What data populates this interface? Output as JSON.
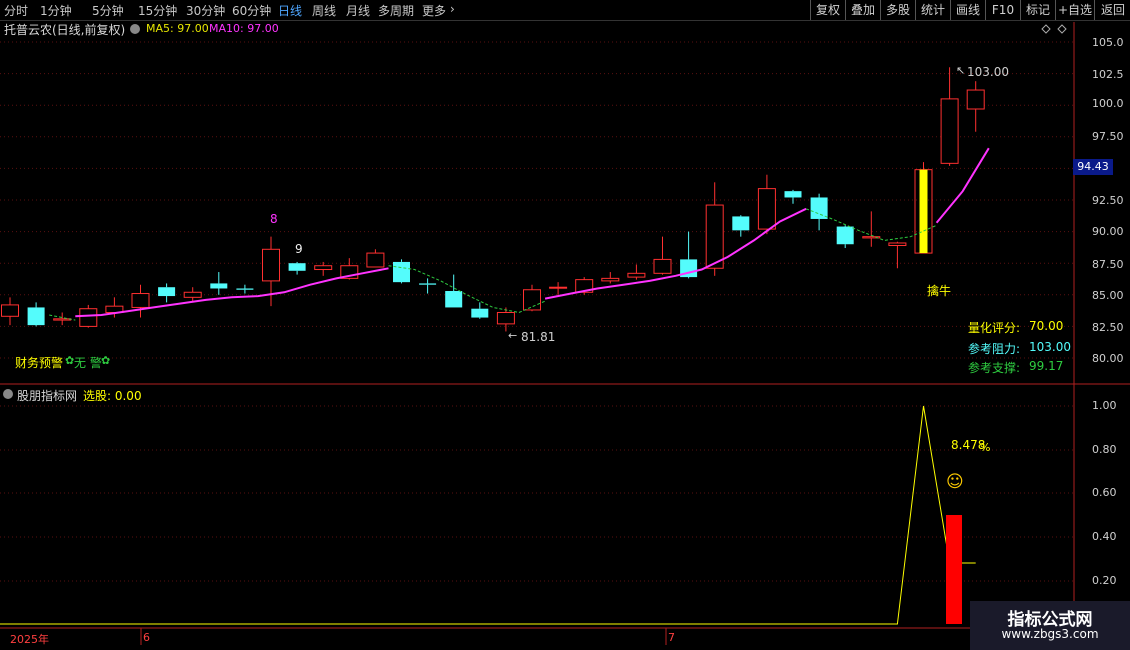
{
  "toolbar": {
    "periods": [
      "分时",
      "1分钟",
      "5分钟",
      "15分钟",
      "30分钟",
      "60分钟",
      "日线",
      "周线",
      "月线",
      "多周期",
      "更多"
    ],
    "active_period": "日线",
    "more_arrow": "›",
    "right_buttons": [
      "复权",
      "叠加",
      "多股",
      "统计",
      "画线",
      "F10",
      "标记",
      "+自选",
      "返回"
    ]
  },
  "main_chart": {
    "title": "托普云农(日线,前复权)",
    "ma5": "MA5: 97.00",
    "ma10": "MA10: 97.00",
    "y_ticks": [
      "105.0",
      "102.5",
      "100.0",
      "97.50",
      "95.00",
      "92.50",
      "90.00",
      "87.50",
      "85.00",
      "82.50",
      "80.00"
    ],
    "current_price": "94.43",
    "high_label": "103.00",
    "low_label": "81.81",
    "count_8": "8",
    "count_9": "9",
    "signal_label": "擒牛",
    "finance_warning": "财务预警",
    "finance_status": "无 警",
    "score_label": "量化评分:",
    "score_value": "70.00",
    "resist_label": "参考阻力:",
    "resist_value": "103.00",
    "support_label": "参考支撑:",
    "support_value": "99.17",
    "colors": {
      "up": "#ff3030",
      "down": "#54fcfc",
      "ma10": "#ff33ff",
      "ma5": "#e6e600",
      "signal": "#ffff00"
    }
  },
  "sub_chart": {
    "title": "股朋指标网",
    "select_label": "选股: 0.00",
    "y_ticks": [
      "1.00",
      "0.80",
      "0.60",
      "0.40",
      "0.20"
    ],
    "percent_label": "8.478",
    "percent_sign": "%",
    "smiley": "☺"
  },
  "date_axis": [
    "2025年",
    "6",
    "7"
  ],
  "watermark": {
    "title": "指标公式网",
    "url": "www.zbgs3.com"
  },
  "chart_data": {
    "type": "candlestick",
    "title": "托普云农(日线,前复权)",
    "ylim": [
      78.5,
      106
    ],
    "candles": [
      {
        "o": 83.3,
        "c": 84.2,
        "h": 84.8,
        "l": 82.6
      },
      {
        "o": 84.0,
        "c": 82.6,
        "h": 84.4,
        "l": 82.5
      },
      {
        "o": 83.0,
        "c": 83.1,
        "h": 83.6,
        "l": 82.6
      },
      {
        "o": 82.5,
        "c": 83.9,
        "h": 84.2,
        "l": 82.4
      },
      {
        "o": 83.6,
        "c": 84.1,
        "h": 84.8,
        "l": 83.2
      },
      {
        "o": 84.0,
        "c": 85.1,
        "h": 85.8,
        "l": 83.2
      },
      {
        "o": 85.6,
        "c": 84.9,
        "h": 85.9,
        "l": 84.4
      },
      {
        "o": 84.8,
        "c": 85.2,
        "h": 85.6,
        "l": 84.4
      },
      {
        "o": 85.9,
        "c": 85.5,
        "h": 86.8,
        "l": 85.0
      },
      {
        "o": 85.5,
        "c": 85.4,
        "h": 85.8,
        "l": 85.1
      },
      {
        "o": 86.1,
        "c": 88.6,
        "h": 89.6,
        "l": 84.1
      },
      {
        "o": 87.5,
        "c": 86.9,
        "h": 87.6,
        "l": 86.6
      },
      {
        "o": 87.0,
        "c": 87.3,
        "h": 87.6,
        "l": 86.5
      },
      {
        "o": 86.3,
        "c": 87.3,
        "h": 87.9,
        "l": 86.2
      },
      {
        "o": 87.2,
        "c": 88.3,
        "h": 88.6,
        "l": 87.2
      },
      {
        "o": 87.6,
        "c": 86.0,
        "h": 87.8,
        "l": 85.9
      },
      {
        "o": 85.9,
        "c": 85.8,
        "h": 86.3,
        "l": 85.1
      },
      {
        "o": 85.3,
        "c": 84.0,
        "h": 86.6,
        "l": 84.0
      },
      {
        "o": 83.9,
        "c": 83.2,
        "h": 84.4,
        "l": 83.1
      },
      {
        "o": 82.7,
        "c": 83.6,
        "h": 84.0,
        "l": 82.1
      },
      {
        "o": 83.8,
        "c": 85.4,
        "h": 85.8,
        "l": 83.7
      },
      {
        "o": 85.6,
        "c": 85.6,
        "h": 86.0,
        "l": 85.0
      },
      {
        "o": 85.2,
        "c": 86.2,
        "h": 86.4,
        "l": 85.0
      },
      {
        "o": 86.1,
        "c": 86.3,
        "h": 86.8,
        "l": 85.9
      },
      {
        "o": 86.4,
        "c": 86.7,
        "h": 87.4,
        "l": 86.2
      },
      {
        "o": 86.7,
        "c": 87.8,
        "h": 89.6,
        "l": 86.6
      },
      {
        "o": 87.8,
        "c": 86.4,
        "h": 90.0,
        "l": 86.3
      },
      {
        "o": 87.1,
        "c": 92.1,
        "h": 93.9,
        "l": 86.5
      },
      {
        "o": 91.2,
        "c": 90.1,
        "h": 91.3,
        "l": 89.6
      },
      {
        "o": 90.2,
        "c": 93.4,
        "h": 94.5,
        "l": 89.8
      },
      {
        "o": 93.2,
        "c": 92.7,
        "h": 93.3,
        "l": 92.2
      },
      {
        "o": 92.7,
        "c": 91.0,
        "h": 93.0,
        "l": 90.1
      },
      {
        "o": 90.4,
        "c": 89.0,
        "h": 90.5,
        "l": 88.7
      },
      {
        "o": 89.5,
        "c": 89.6,
        "h": 91.6,
        "l": 88.8
      },
      {
        "o": 88.9,
        "c": 89.1,
        "h": 89.2,
        "l": 87.1
      },
      {
        "o": 88.3,
        "c": 94.9,
        "h": 95.5,
        "l": 88.3
      },
      {
        "o": 95.4,
        "c": 100.5,
        "h": 103.0,
        "l": 95.2
      },
      {
        "o": 99.7,
        "c": 101.2,
        "h": 101.9,
        "l": 97.9
      }
    ],
    "ma10": [
      null,
      null,
      83.3,
      83.4,
      83.7,
      84.0,
      84.3,
      84.6,
      84.8,
      84.9,
      85.2,
      85.8,
      86.3,
      86.7,
      87.1,
      null,
      null,
      null,
      null,
      null,
      84.7,
      85.1,
      85.5,
      85.8,
      86.1,
      86.5,
      87.0,
      88.0,
      89.3,
      90.8,
      91.8,
      null,
      null,
      null,
      null,
      90.7,
      93.2,
      96.6
    ],
    "ma_dashed": [
      null,
      83.4,
      83.0,
      null,
      null,
      null,
      null,
      null,
      null,
      null,
      null,
      null,
      null,
      null,
      87.3,
      87.0,
      86.1,
      85.0,
      84.0,
      83.6,
      84.5,
      null,
      null,
      null,
      null,
      null,
      null,
      null,
      null,
      null,
      91.8,
      91.0,
      90.1,
      89.3,
      89.6,
      90.5
    ],
    "volume_curve": [
      0,
      0,
      0,
      0,
      0,
      0,
      0,
      0,
      0,
      0,
      0,
      0,
      0,
      0,
      0,
      0,
      0,
      0,
      0,
      0,
      0,
      0,
      0,
      0,
      0,
      0,
      0,
      0,
      0,
      0,
      0,
      0,
      0,
      0,
      0,
      1.0,
      0.28,
      0.28
    ],
    "signal_bar": 0.5,
    "signal_index": 35
  }
}
